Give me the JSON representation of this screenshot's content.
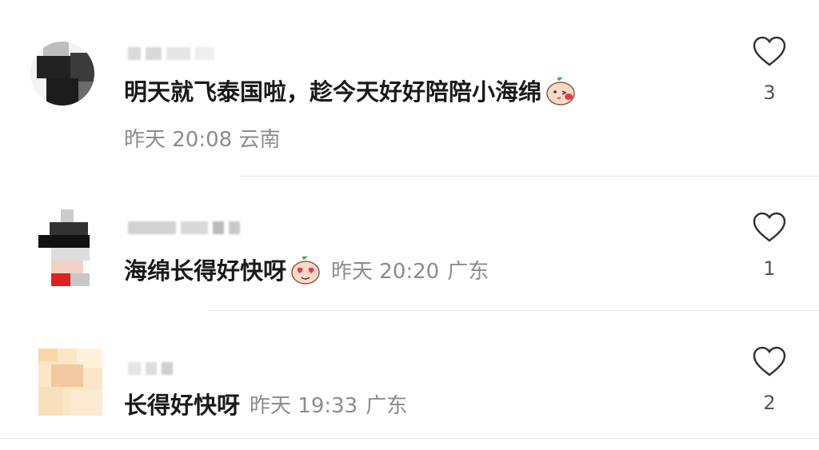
{
  "comments": [
    {
      "text": "明天就飞泰国啦，趁今天好好陪陪小海绵",
      "emoji": "blush-peach-emoji",
      "time": "昨天 20:08",
      "location": "云南",
      "likes": "3"
    },
    {
      "text": "海绵长得好快呀",
      "emoji": "heart-eyes-peach-emoji",
      "time": "昨天 20:20",
      "location": "广东",
      "likes": "1"
    },
    {
      "text": "长得好快呀",
      "emoji": "",
      "time": "昨天 19:33",
      "location": "广东",
      "likes": "2"
    }
  ],
  "colors": {
    "text": "#1a1a1a",
    "meta": "#8c8c8c",
    "heart": "#333333"
  }
}
